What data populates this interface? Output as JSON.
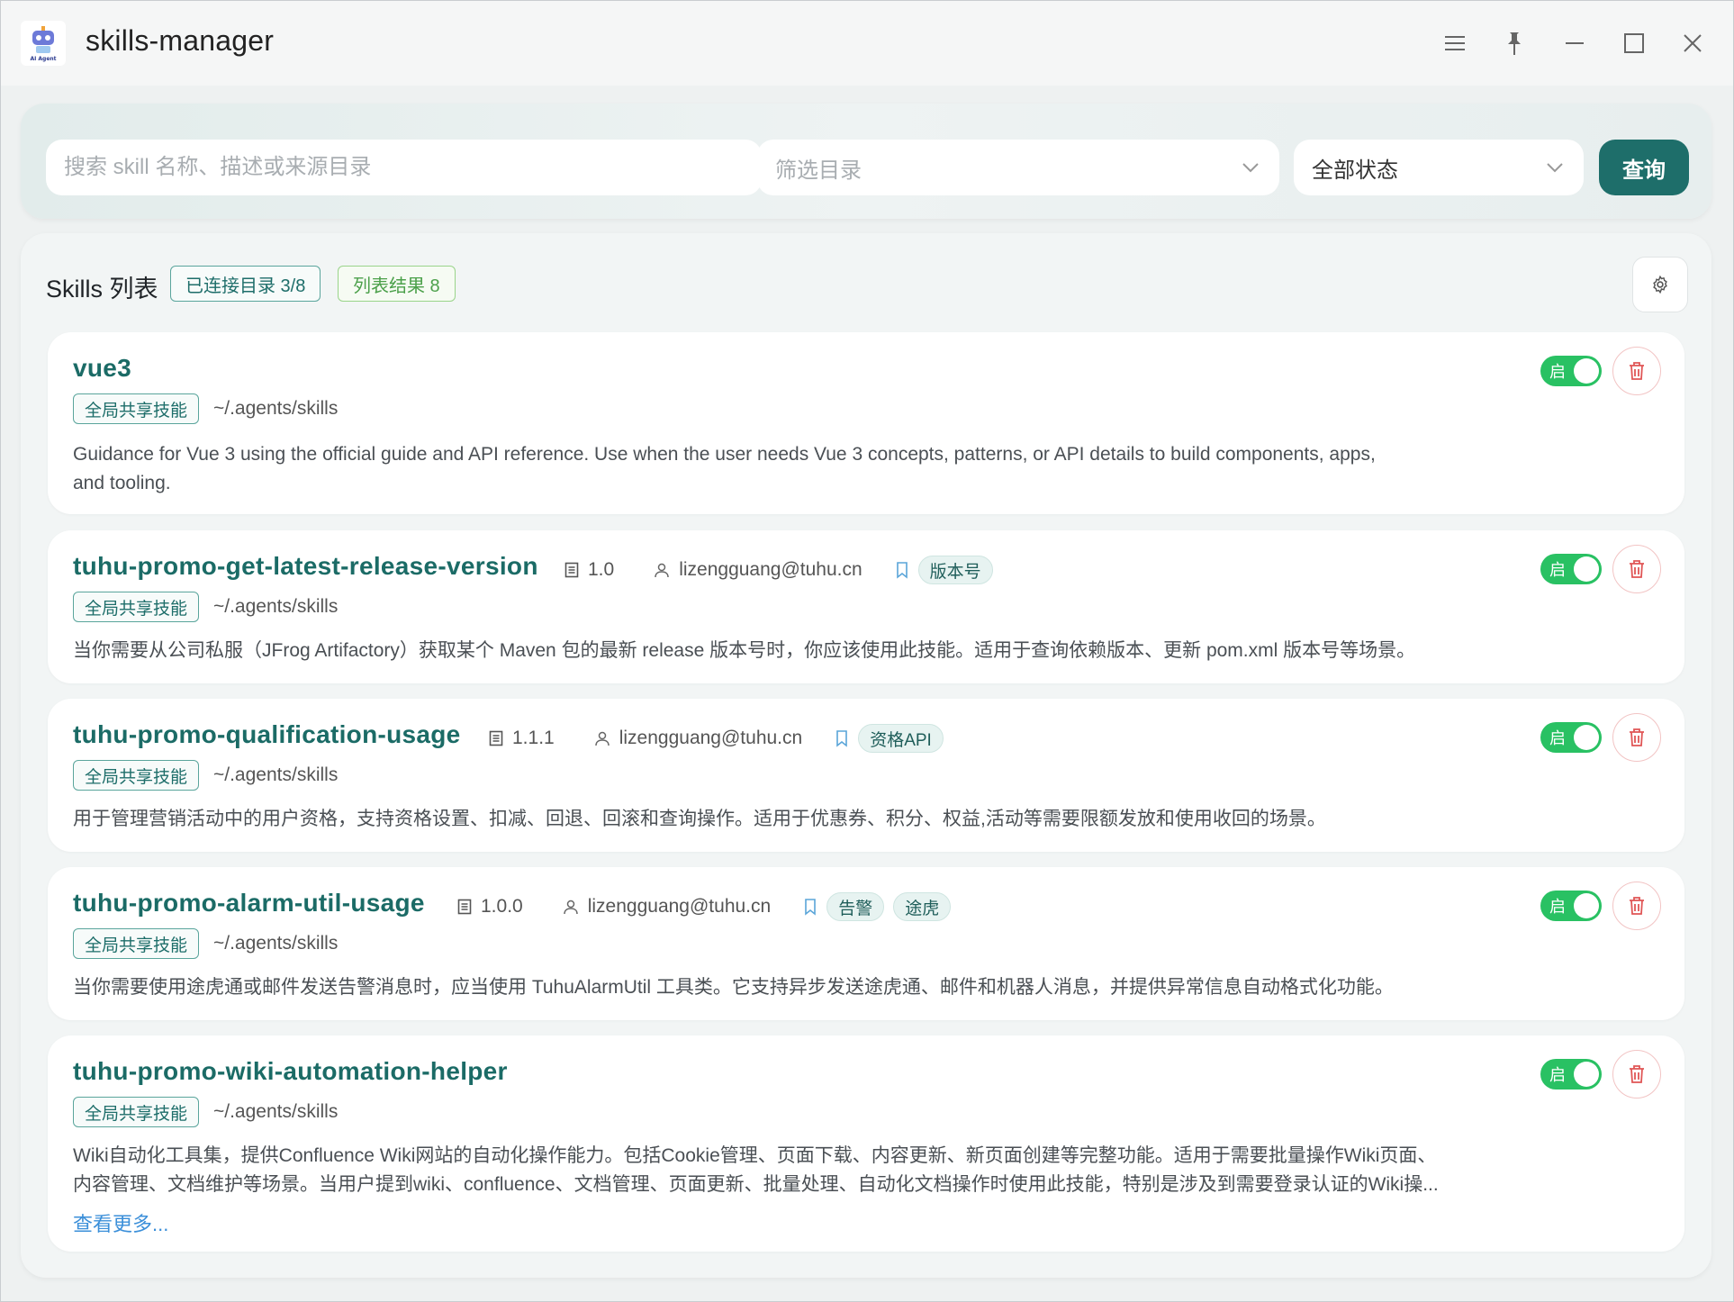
{
  "window": {
    "title": "skills-manager",
    "logo_text": "AI Agent",
    "controls": [
      "menu-icon",
      "pin-icon",
      "minimize-icon",
      "maximize-icon",
      "close-icon"
    ]
  },
  "search": {
    "placeholder": "搜索 skill 名称、描述或来源目录",
    "dir_filter_placeholder": "筛选目录",
    "status_filter_value": "全部状态",
    "query_label": "查询"
  },
  "list": {
    "title": "Skills 列表",
    "connected_dirs": "已连接目录 3/8",
    "result_count": "列表结果 8"
  },
  "skills": [
    {
      "name": "vue3",
      "version": "",
      "author": "",
      "tags": [],
      "scope": "全局共享技能",
      "path": "~/.agents/skills",
      "desc_line1": "Guidance for Vue 3 using the official guide and API reference. Use when the user needs Vue 3 concepts, patterns, or API details to build components, apps,",
      "desc_line2": "and tooling.",
      "enabled_label": "启",
      "enabled": true
    },
    {
      "name": "tuhu-promo-get-latest-release-version",
      "version": "1.0",
      "author": "lizengguang@tuhu.cn",
      "tags": [
        "版本号"
      ],
      "scope": "全局共享技能",
      "path": "~/.agents/skills",
      "desc_line1": "当你需要从公司私服（JFrog Artifactory）获取某个 Maven 包的最新 release 版本号时，你应该使用此技能。适用于查询依赖版本、更新 pom.xml 版本号等场景。",
      "enabled_label": "启",
      "enabled": true
    },
    {
      "name": "tuhu-promo-qualification-usage",
      "version": "1.1.1",
      "author": "lizengguang@tuhu.cn",
      "tags": [
        "资格API"
      ],
      "scope": "全局共享技能",
      "path": "~/.agents/skills",
      "desc_line1": "用于管理营销活动中的用户资格，支持资格设置、扣减、回退、回滚和查询操作。适用于优惠券、积分、权益,活动等需要限额发放和使用收回的场景。",
      "enabled_label": "启",
      "enabled": true
    },
    {
      "name": "tuhu-promo-alarm-util-usage",
      "version": "1.0.0",
      "author": "lizengguang@tuhu.cn",
      "tags": [
        "告警",
        "途虎"
      ],
      "scope": "全局共享技能",
      "path": "~/.agents/skills",
      "desc_line1": "当你需要使用途虎通或邮件发送告警消息时，应当使用 TuhuAlarmUtil 工具类。它支持异步发送途虎通、邮件和机器人消息，并提供异常信息自动格式化功能。",
      "enabled_label": "启",
      "enabled": true
    },
    {
      "name": "tuhu-promo-wiki-automation-helper",
      "version": "",
      "author": "",
      "tags": [],
      "scope": "全局共享技能",
      "path": "~/.agents/skills",
      "desc_line1": "Wiki自动化工具集，提供Confluence Wiki网站的自动化操作能力。包括Cookie管理、页面下载、内容更新、新页面创建等完整功能。适用于需要批量操作Wiki页面、",
      "desc_line2": "内容管理、文档维护等场景。当用户提到wiki、confluence、文档管理、页面更新、批量处理、自动化文档操作时使用此技能，特别是涉及到需要登录认证的Wiki操...",
      "more_label": "查看更多...",
      "enabled_label": "启",
      "enabled": true
    }
  ],
  "colors": {
    "accent": "#1e6e6a",
    "toggle_on": "#29c163",
    "delete": "#e05656",
    "link": "#3b8fd9"
  }
}
